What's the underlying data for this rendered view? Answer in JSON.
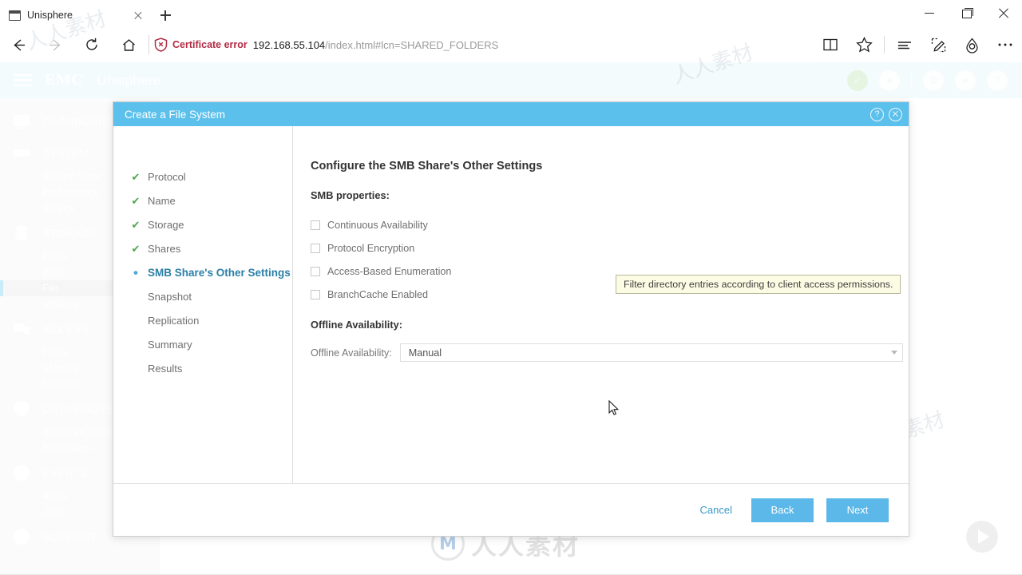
{
  "browser": {
    "tab": {
      "title": "Unisphere",
      "favicon_icon": "page-icon",
      "close_icon": "close-icon"
    },
    "new_tab_label": "+",
    "window_controls": {
      "minimize": "—",
      "maximize": "❐",
      "close": "✕"
    },
    "nav": {
      "back_icon": "back-arrow-icon",
      "forward_icon": "forward-arrow-icon",
      "refresh_icon": "refresh-icon",
      "home_icon": "home-icon"
    },
    "address": {
      "security_label": "Certificate error",
      "security_icon": "shield-warning-icon",
      "url_host": "192.168.55.104",
      "url_path": "/index.html#lcn=SHARED_FOLDERS"
    },
    "toolbar": {
      "reading_view_icon": "book-icon",
      "favorites_icon": "star-icon",
      "hub_icon": "hub-lines-icon",
      "notes_icon": "web-note-icon",
      "share_icon": "share-icon",
      "more_icon": "ellipsis-icon"
    }
  },
  "app": {
    "brand": "EMC",
    "brand_tm": "²",
    "product": "Unisphere",
    "menu_icon": "hamburger-icon",
    "header_icons": [
      {
        "name": "status-ok-icon",
        "glyph": "✓"
      },
      {
        "name": "alerts-bell-icon",
        "glyph": "●"
      },
      {
        "name": "settings-gear-icon",
        "glyph": "⚙"
      },
      {
        "name": "user-account-icon",
        "glyph": "●"
      },
      {
        "name": "help-icon",
        "glyph": "?"
      }
    ],
    "sidebar": [
      {
        "label": "DASHBOARD",
        "icon": "dashboard-icon",
        "children": []
      },
      {
        "label": "SYSTEM",
        "icon": "system-icon",
        "children": [
          {
            "label": "System View",
            "active": false
          },
          {
            "label": "Performance",
            "active": false
          },
          {
            "label": "Service",
            "active": false
          }
        ]
      },
      {
        "label": "STORAGE",
        "icon": "storage-icon",
        "children": [
          {
            "label": "Pools",
            "active": false
          },
          {
            "label": "Block",
            "active": false
          },
          {
            "label": "File",
            "active": true
          },
          {
            "label": "VMware",
            "active": false
          }
        ]
      },
      {
        "label": "ACCESS",
        "icon": "access-icon",
        "children": [
          {
            "label": "Hosts",
            "active": false
          },
          {
            "label": "VMware",
            "active": false
          },
          {
            "label": "Initiators",
            "active": false
          }
        ]
      },
      {
        "label": "DATA PROTECTION",
        "icon": "shield-icon",
        "children": [
          {
            "label": "Snapshot Schedule",
            "active": false
          },
          {
            "label": "Replication",
            "active": false
          }
        ]
      },
      {
        "label": "EVENTS",
        "icon": "events-icon",
        "children": [
          {
            "label": "Alerts",
            "active": false
          },
          {
            "label": "Jobs",
            "active": false
          }
        ]
      },
      {
        "label": "SUPPORT",
        "icon": "support-icon",
        "children": []
      }
    ]
  },
  "dialog": {
    "title": "Create a File System",
    "help_icon": "help-circle-icon",
    "close_icon": "close-circle-icon",
    "steps": [
      {
        "label": "Protocol",
        "state": "done"
      },
      {
        "label": "Name",
        "state": "done"
      },
      {
        "label": "Storage",
        "state": "done"
      },
      {
        "label": "Shares",
        "state": "done"
      },
      {
        "label": "SMB Share's Other Settings",
        "state": "active"
      },
      {
        "label": "Snapshot",
        "state": "pending"
      },
      {
        "label": "Replication",
        "state": "pending"
      },
      {
        "label": "Summary",
        "state": "pending"
      },
      {
        "label": "Results",
        "state": "pending"
      }
    ],
    "panel": {
      "heading": "Configure the SMB Share's Other Settings",
      "smb_properties_label": "SMB properties:",
      "checkboxes": [
        {
          "label": "Continuous Availability",
          "checked": false
        },
        {
          "label": "Protocol Encryption",
          "checked": false
        },
        {
          "label": "Access-Based Enumeration",
          "checked": false
        },
        {
          "label": "BranchCache Enabled",
          "checked": false
        }
      ],
      "offline_section_label": "Offline Availability:",
      "offline_field_label": "Offline Availability:",
      "offline_value": "Manual",
      "dropdown_caret_icon": "chevron-down-icon"
    },
    "tooltip": "Filter directory entries according to client access permissions.",
    "footer": {
      "cancel": "Cancel",
      "back": "Back",
      "next": "Next"
    }
  },
  "watermark": {
    "logo_mark": "M",
    "logo_text": "人人素材",
    "tiles": "人人素材"
  },
  "colors": {
    "accent": "#5bc0eb",
    "dialog_title_bg": "#5bc0eb",
    "button_bg": "#5bb8e8",
    "active_step": "#2b7fa8",
    "done_check": "#4ca64c",
    "cert_error": "#b32b45",
    "tooltip_bg": "#fcfce4",
    "header_bg": "#d9f2fa"
  }
}
